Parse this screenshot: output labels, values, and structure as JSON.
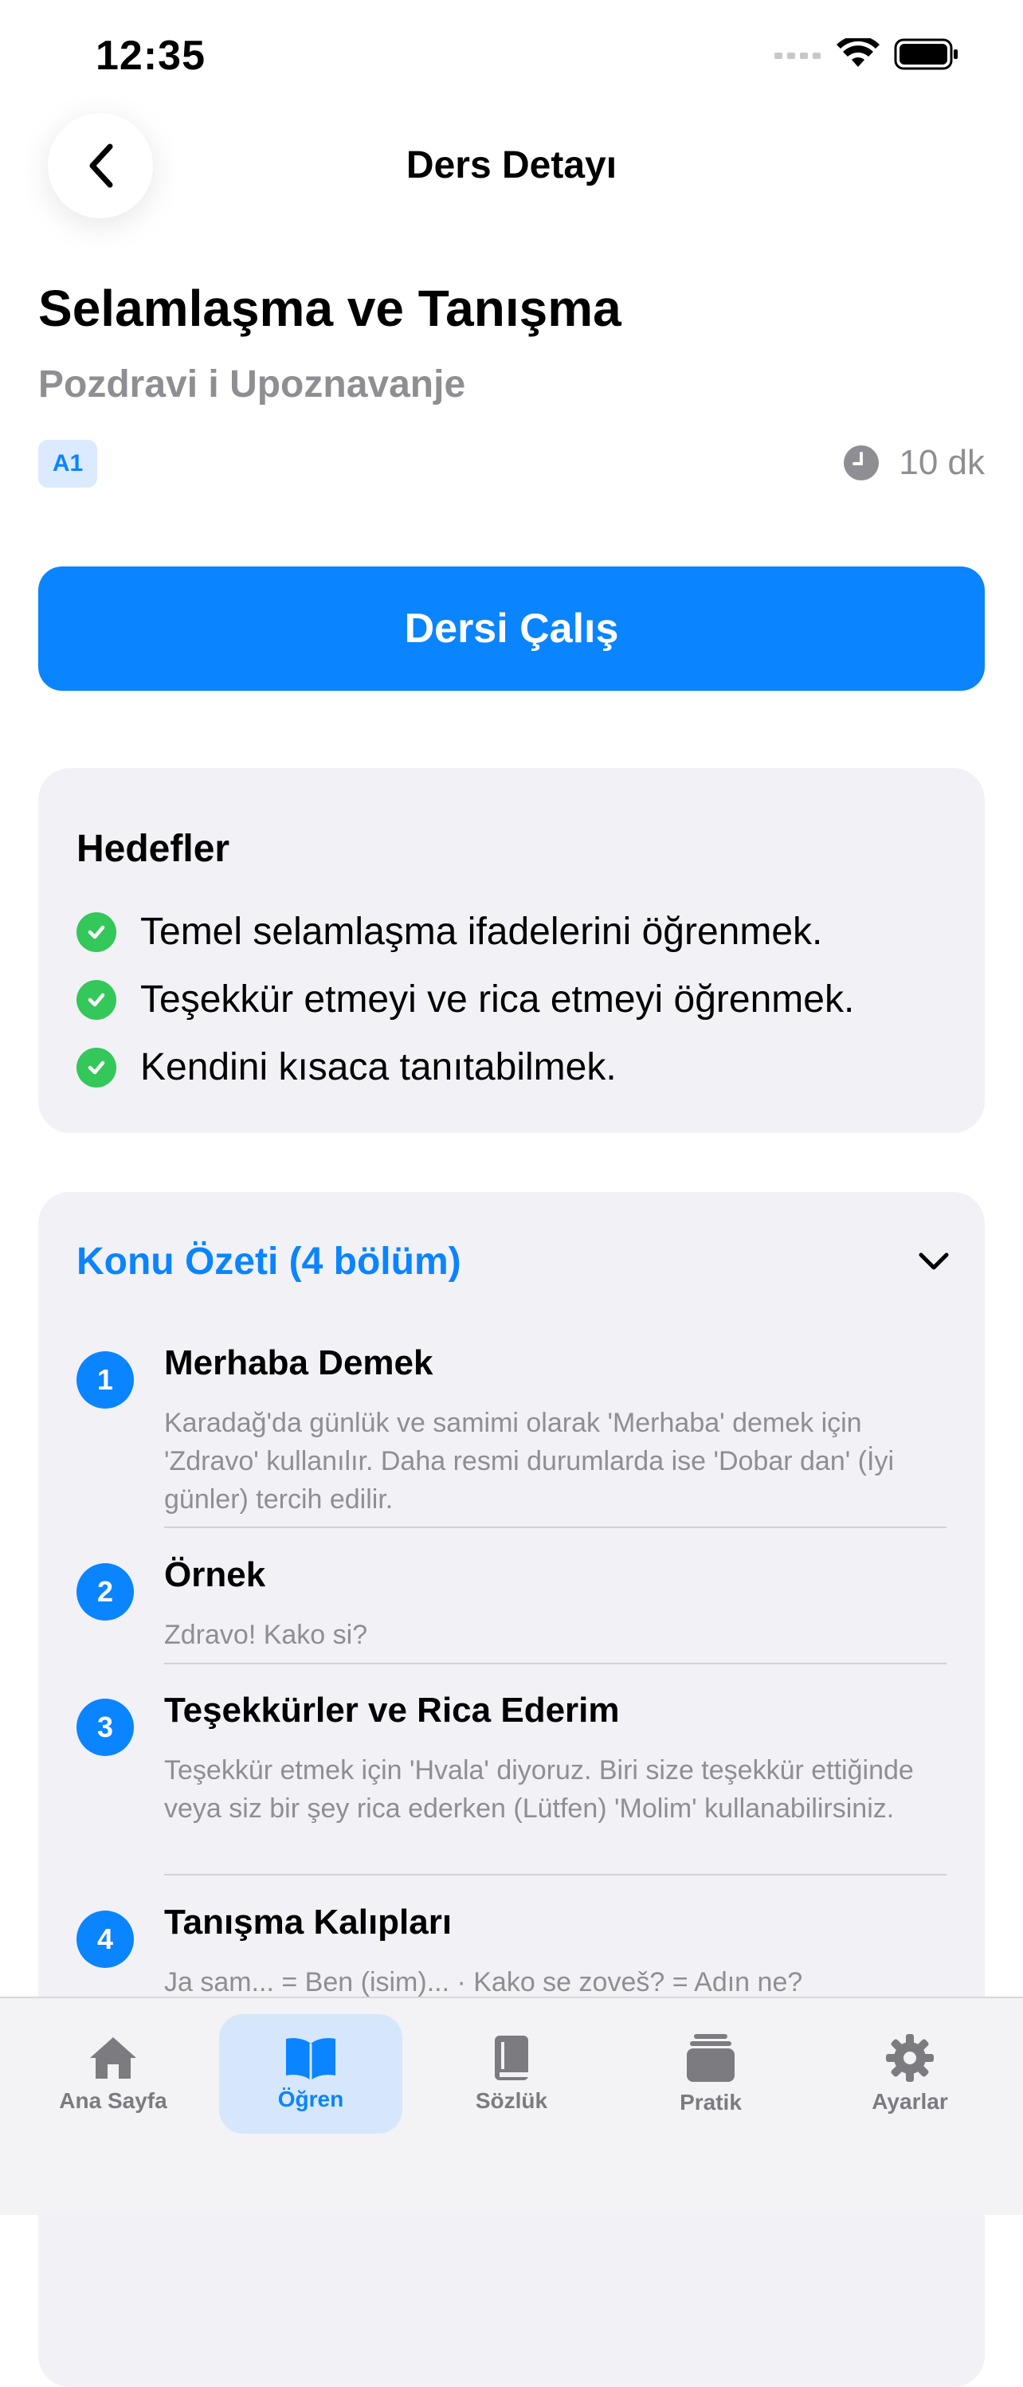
{
  "status_bar": {
    "time": "12:35"
  },
  "header": {
    "title": "Ders Detayı"
  },
  "lesson": {
    "title": "Selamlaşma ve Tanışma",
    "subtitle": "Pozdravi i Upoznavanje",
    "level": "A1",
    "duration": "10 dk",
    "study_button": "Dersi Çalış"
  },
  "goals": {
    "heading": "Hedefler",
    "items": [
      "Temel selamlaşma ifadelerini öğrenmek.",
      "Teşekkür etmeyi ve rica etmeyi öğrenmek.",
      "Kendini kısaca tanıtabilmek."
    ]
  },
  "summary": {
    "heading": "Konu Özeti (4 bölüm)",
    "sections": [
      {
        "number": "1",
        "title": "Merhaba Demek",
        "body": "Karadağ'da günlük ve samimi olarak 'Merhaba' demek için 'Zdravo' kullanılır. Daha resmi durumlarda ise 'Dobar dan' (İyi günler) tercih edilir."
      },
      {
        "number": "2",
        "title": "Örnek",
        "body": "Zdravo! Kako si?"
      },
      {
        "number": "3",
        "title": "Teşekkürler ve Rica Ederim",
        "body": "Teşekkür etmek için 'Hvala' diyoruz. Biri size teşekkür ettiğinde veya siz bir şey rica ederken (Lütfen) 'Molim' kullanabilirsiniz."
      },
      {
        "number": "4",
        "title": "Tanışma Kalıpları",
        "body": "Ja sam... = Ben (isim)... · Kako se zoveš? = Adın ne?"
      }
    ]
  },
  "tabs": [
    {
      "label": "Ana Sayfa",
      "icon": "house-icon"
    },
    {
      "label": "Öğren",
      "icon": "book-open-icon",
      "active": true
    },
    {
      "label": "Sözlük",
      "icon": "book-icon"
    },
    {
      "label": "Pratik",
      "icon": "stack-icon"
    },
    {
      "label": "Ayarlar",
      "icon": "gear-icon"
    }
  ],
  "colors": {
    "accent": "#0a84ff",
    "success": "#34c759",
    "muted": "#8e8e93",
    "card": "#f1f1f6"
  }
}
